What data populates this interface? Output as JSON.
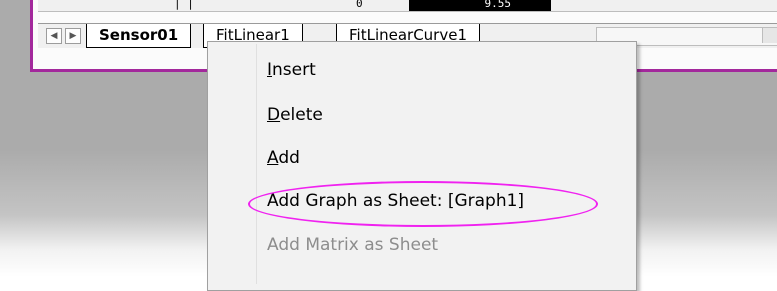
{
  "grid": {
    "cell_value_1": "0",
    "cell_value_2": "9.55"
  },
  "tabs": [
    {
      "label": "Sensor01",
      "active": true
    },
    {
      "label": "FitLinear1",
      "active": false
    },
    {
      "label": "FitLinearCurve1",
      "active": false
    }
  ],
  "nav": {
    "prev_icon": "chevron-left-icon",
    "next_icon": "chevron-right-icon"
  },
  "menu": {
    "items": [
      {
        "mnemonic": "I",
        "rest": "nsert",
        "enabled": true
      },
      {
        "mnemonic": "D",
        "rest": "elete",
        "enabled": true
      },
      {
        "mnemonic": "A",
        "rest": "dd",
        "enabled": true
      },
      {
        "label": "Add Graph as Sheet: [Graph1]",
        "enabled": true
      },
      {
        "label": "Add Matrix as Sheet",
        "enabled": false
      }
    ]
  },
  "colors": {
    "workbook_border": "#a3289c",
    "highlight": "#f022f0",
    "disabled_text": "#8d8d8d"
  }
}
